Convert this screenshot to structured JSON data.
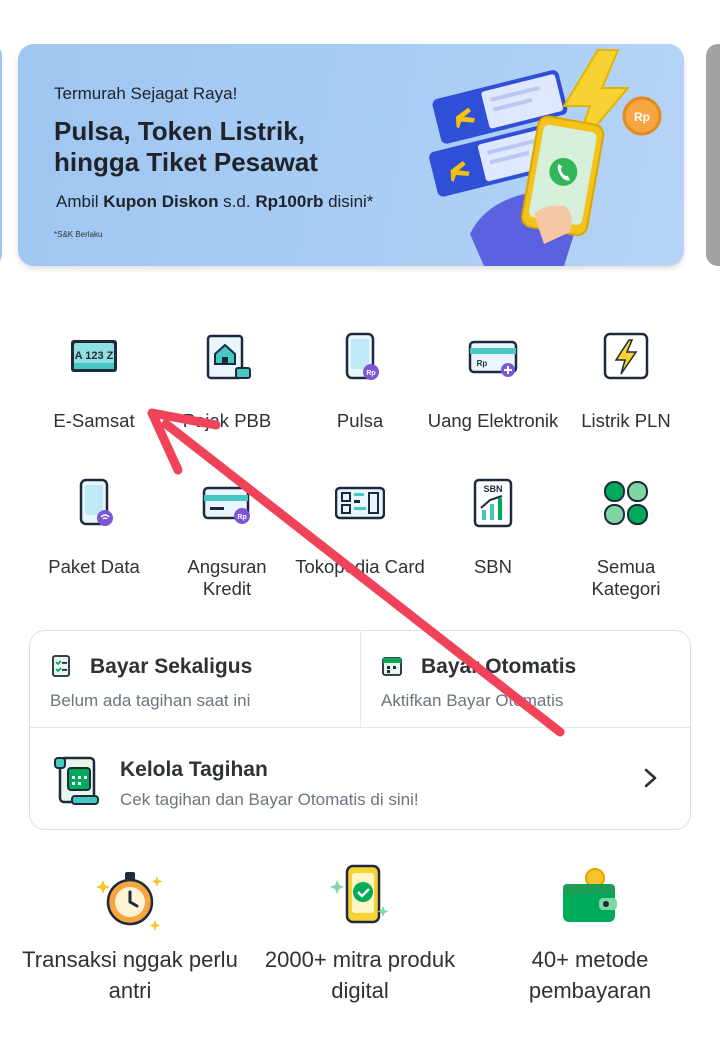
{
  "banner": {
    "eyebrow": "Termurah Sejagat Raya!",
    "headline": "Pulsa, Token Listrik, hingga Tiket Pesawat",
    "offer_prefix": "Ambil ",
    "offer_bold1": "Kupon Diskon",
    "offer_mid": " s.d. ",
    "offer_bold2": "Rp100rb",
    "offer_suffix": " disini*",
    "fineprint": "*S&K Berlaku",
    "coin_label": "Rp"
  },
  "categories": [
    {
      "label": "E-Samsat",
      "icon": "license-plate-icon",
      "plate": "A 123 Z"
    },
    {
      "label": "Pajak PBB",
      "icon": "house-scroll-icon"
    },
    {
      "label": "Pulsa",
      "icon": "phone-rp-icon"
    },
    {
      "label": "Uang Elektronik",
      "icon": "emoney-card-icon"
    },
    {
      "label": "Listrik PLN",
      "icon": "lightning-icon"
    },
    {
      "label": "Paket Data",
      "icon": "phone-wifi-icon"
    },
    {
      "label": "Angsuran Kredit",
      "icon": "credit-card-icon"
    },
    {
      "label": "Tokopedia Card",
      "icon": "qr-card-icon"
    },
    {
      "label": "SBN",
      "icon": "sbn-chart-icon",
      "tag": "SBN"
    },
    {
      "label": "Semua Kategori",
      "icon": "all-categories-icon"
    }
  ],
  "bills": {
    "bayar_sekaligus": {
      "title": "Bayar Sekaligus",
      "sub": "Belum ada tagihan saat ini"
    },
    "bayar_otomatis": {
      "title": "Bayar Otomatis",
      "sub": "Aktifkan Bayar Otomatis"
    },
    "kelola": {
      "title": "Kelola Tagihan",
      "sub": "Cek tagihan dan Bayar Otomatis di sini!"
    }
  },
  "features": [
    {
      "text": "Transaksi nggak perlu antri",
      "icon": "stopwatch-icon"
    },
    {
      "text": "2000+ mitra produk digital",
      "icon": "phone-badge-icon"
    },
    {
      "text": "40+ metode pembayaran",
      "icon": "wallet-icon"
    }
  ],
  "colors": {
    "accent": "#00aa5b",
    "annotation": "#f0435a",
    "banner": "#a9cdf5"
  }
}
